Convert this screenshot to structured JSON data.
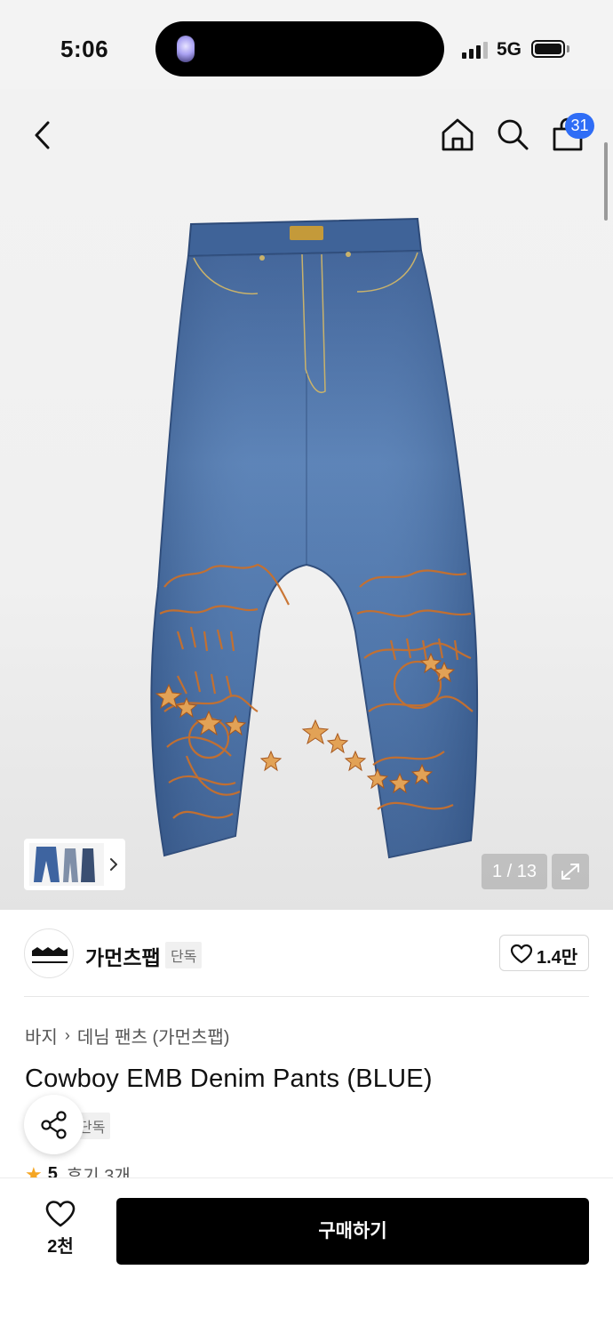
{
  "status_bar": {
    "time": "5:06",
    "network": "5G"
  },
  "header": {
    "cart_count": "31"
  },
  "gallery": {
    "counter": "1 / 13"
  },
  "brand": {
    "name": "가먼츠팹",
    "tag": "단독",
    "logo_text": "GARMENTS FAB",
    "likes": "1.4만"
  },
  "breadcrumb": {
    "items": [
      "바지",
      "데님 팬츠 (가먼츠팹)"
    ]
  },
  "product": {
    "title": "Cowboy EMB Denim Pants (BLUE)",
    "tag": "단독",
    "rating": "5",
    "reviews": "후기 3개"
  },
  "bottom": {
    "wish_count": "2천",
    "buy_label": "구매하기"
  },
  "colors": {
    "badge": "#2f6df6",
    "star": "#f5a623",
    "denim": "#4a72a8",
    "embroidery": "#c8702c"
  }
}
